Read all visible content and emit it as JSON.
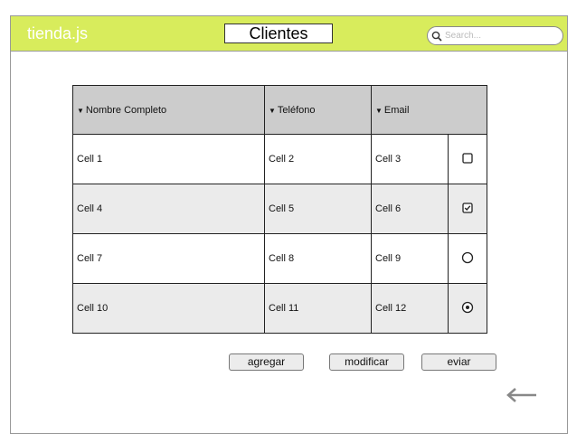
{
  "header": {
    "brand": "tienda.js",
    "title": "Clientes",
    "search_placeholder": "Search..."
  },
  "table": {
    "columns": [
      "Nombre Completo",
      "Teléfono",
      "Email"
    ],
    "rows": [
      {
        "cells": [
          "Cell 1",
          "Cell 2",
          "Cell 3"
        ],
        "control": "checkbox-unchecked"
      },
      {
        "cells": [
          "Cell 4",
          "Cell 5",
          "Cell 6"
        ],
        "control": "checkbox-checked"
      },
      {
        "cells": [
          "Cell 7",
          "Cell 8",
          "Cell 9"
        ],
        "control": "radio-unselected"
      },
      {
        "cells": [
          "Cell 10",
          "Cell 11",
          "Cell 12"
        ],
        "control": "radio-selected"
      }
    ]
  },
  "actions": {
    "add": "agregar",
    "modify": "modificar",
    "send": "eviar"
  },
  "icons": {
    "search": "search-icon",
    "back": "arrow-left-icon",
    "sort": "caret-down-icon"
  },
  "colors": {
    "topbar": "#d8ec5c",
    "header_row": "#cccccc",
    "alt_row": "#ebebeb"
  }
}
